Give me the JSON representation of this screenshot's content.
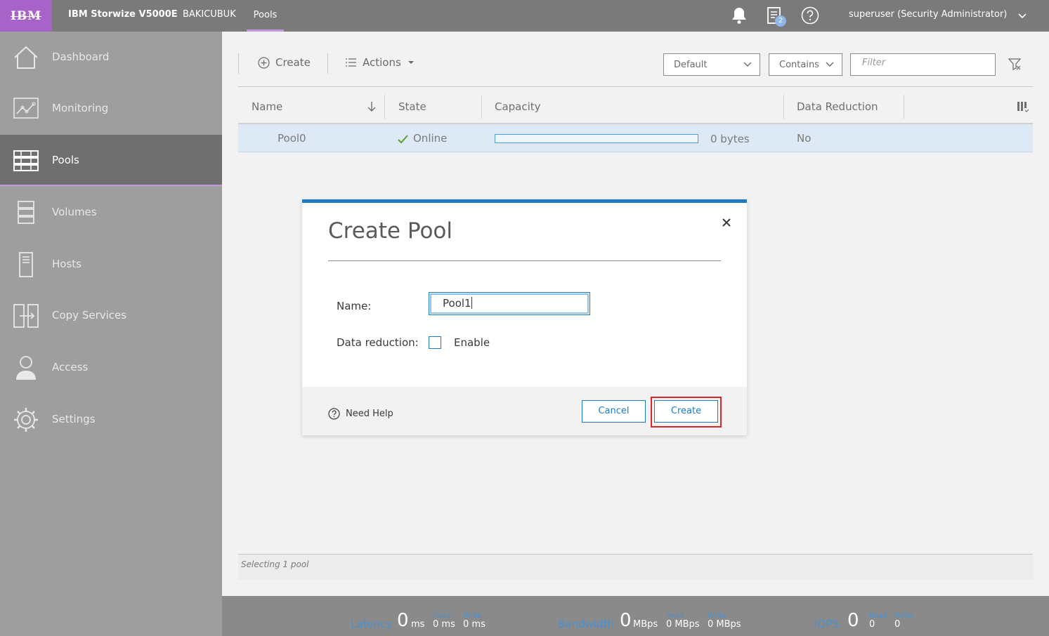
{
  "topbar": {
    "logo": "IBM",
    "product": "IBM Storwize V5000E",
    "system": "BAKICUBUK",
    "breadcrumb": "Pools",
    "notifications_badge": "2",
    "user": "superuser (Security Administrator)"
  },
  "sidebar": {
    "items": [
      {
        "label": "Dashboard",
        "icon": "home-icon"
      },
      {
        "label": "Monitoring",
        "icon": "monitoring-icon"
      },
      {
        "label": "Pools",
        "icon": "pools-icon",
        "active": true
      },
      {
        "label": "Volumes",
        "icon": "volumes-icon"
      },
      {
        "label": "Hosts",
        "icon": "hosts-icon"
      },
      {
        "label": "Copy Services",
        "icon": "copy-services-icon"
      },
      {
        "label": "Access",
        "icon": "user-icon"
      },
      {
        "label": "Settings",
        "icon": "gear-icon"
      }
    ]
  },
  "toolbar": {
    "create": "Create",
    "actions": "Actions",
    "view_select": "Default",
    "match_select": "Contains",
    "filter_placeholder": "Filter"
  },
  "table": {
    "columns": [
      "Name",
      "State",
      "Capacity",
      "Data Reduction"
    ],
    "rows": [
      {
        "name": "Pool0",
        "state": "Online",
        "capacity": "0 bytes",
        "capacity_used_fraction": 0,
        "data_reduction": "No"
      }
    ]
  },
  "status": "Selecting 1 pool",
  "metrics": {
    "latency": {
      "label": "Latency",
      "value": "0",
      "unit": "ms",
      "read_head": "Read",
      "read": "0 ms",
      "write_head": "Write",
      "write": "0 ms"
    },
    "bandwidth": {
      "label": "Bandwidth",
      "value": "0",
      "unit": "MBps",
      "read_head": "Read",
      "read": "0 MBps",
      "write_head": "Write",
      "write": "0 MBps"
    },
    "iops": {
      "label": "IOPS",
      "value": "0",
      "read_head": "Read",
      "read": "0",
      "write_head": "Write",
      "write": "0"
    }
  },
  "modal": {
    "title": "Create Pool",
    "name_label": "Name:",
    "name_value": "Pool1",
    "data_reduction_label": "Data reduction:",
    "enable_label": "Enable",
    "enable_checked": false,
    "help": "Need Help",
    "cancel": "Cancel",
    "create": "Create"
  },
  "colors": {
    "accent": "#1f7ac2",
    "brand": "#a863c8",
    "highlight": "#d9262c",
    "online": "#5aa02c"
  }
}
